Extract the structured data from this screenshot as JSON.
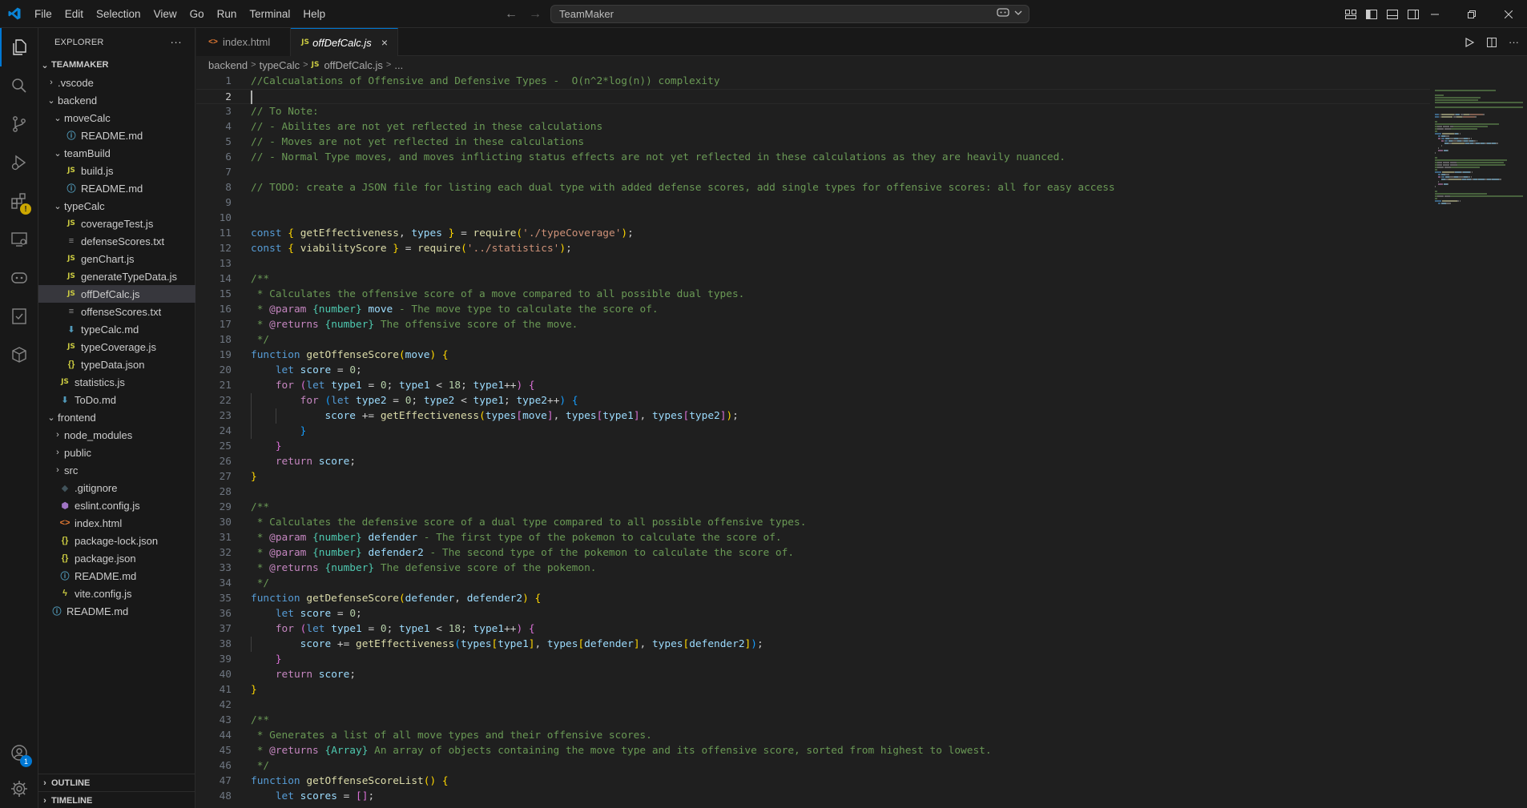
{
  "titlebar": {
    "menu": [
      "File",
      "Edit",
      "Selection",
      "View",
      "Go",
      "Run",
      "Terminal",
      "Help"
    ],
    "search_text": "TeamMaker",
    "icons": [
      "vscode-logo-icon",
      "back-arrow-icon",
      "forward-arrow-icon",
      "copilot-icon",
      "chevron-down-icon",
      "customize-layout-icon",
      "toggle-sidebar-icon",
      "toggle-panel-icon",
      "toggle-secondary-sidebar-icon",
      "minimize-icon",
      "restore-icon",
      "close-icon"
    ]
  },
  "activitybar": {
    "items": [
      "explorer-icon",
      "search-icon",
      "source-control-icon",
      "run-debug-icon",
      "extensions-icon",
      "remote-explorer-icon",
      "copilot-icon",
      "testing-icon",
      "containers-icon"
    ],
    "accounts_badge": "1",
    "bottom": [
      "accounts-icon",
      "manage-gear-icon"
    ]
  },
  "sidebar": {
    "title": "EXPLORER",
    "more": "···",
    "root": "TEAMMAKER",
    "tree": [
      {
        "label": ".vscode",
        "depth": 1,
        "type": "folder",
        "open": false
      },
      {
        "label": "backend",
        "depth": 1,
        "type": "folder",
        "open": true
      },
      {
        "label": "moveCalc",
        "depth": 2,
        "type": "folder",
        "open": true
      },
      {
        "label": "README.md",
        "depth": 3,
        "type": "info"
      },
      {
        "label": "teamBuild",
        "depth": 2,
        "type": "folder",
        "open": true
      },
      {
        "label": "build.js",
        "depth": 3,
        "type": "js"
      },
      {
        "label": "README.md",
        "depth": 3,
        "type": "info"
      },
      {
        "label": "typeCalc",
        "depth": 2,
        "type": "folder",
        "open": true
      },
      {
        "label": "coverageTest.js",
        "depth": 3,
        "type": "js"
      },
      {
        "label": "defenseScores.txt",
        "depth": 3,
        "type": "txt"
      },
      {
        "label": "genChart.js",
        "depth": 3,
        "type": "js"
      },
      {
        "label": "generateTypeData.js",
        "depth": 3,
        "type": "js"
      },
      {
        "label": "offDefCalc.js",
        "depth": 3,
        "type": "js",
        "selected": true
      },
      {
        "label": "offenseScores.txt",
        "depth": 3,
        "type": "txt"
      },
      {
        "label": "typeCalc.md",
        "depth": 3,
        "type": "md"
      },
      {
        "label": "typeCoverage.js",
        "depth": 3,
        "type": "js"
      },
      {
        "label": "typeData.json",
        "depth": 3,
        "type": "json"
      },
      {
        "label": "statistics.js",
        "depth": 2,
        "type": "js"
      },
      {
        "label": "ToDo.md",
        "depth": 2,
        "type": "md"
      },
      {
        "label": "frontend",
        "depth": 1,
        "type": "folder",
        "open": true
      },
      {
        "label": "node_modules",
        "depth": 2,
        "type": "folder",
        "open": false
      },
      {
        "label": "public",
        "depth": 2,
        "type": "folder",
        "open": false
      },
      {
        "label": "src",
        "depth": 2,
        "type": "folder",
        "open": false
      },
      {
        "label": ".gitignore",
        "depth": 2,
        "type": "git"
      },
      {
        "label": "eslint.config.js",
        "depth": 2,
        "type": "eslint"
      },
      {
        "label": "index.html",
        "depth": 2,
        "type": "html"
      },
      {
        "label": "package-lock.json",
        "depth": 2,
        "type": "json"
      },
      {
        "label": "package.json",
        "depth": 2,
        "type": "json"
      },
      {
        "label": "README.md",
        "depth": 2,
        "type": "info"
      },
      {
        "label": "vite.config.js",
        "depth": 2,
        "type": "vite"
      },
      {
        "label": "README.md",
        "depth": 1,
        "type": "info"
      }
    ],
    "outline": "OUTLINE",
    "timeline": "TIMELINE"
  },
  "editor": {
    "tabs": [
      {
        "label": "index.html",
        "icon": "html-file-icon",
        "active": false
      },
      {
        "label": "offDefCalc.js",
        "icon": "js-file-icon",
        "active": true
      }
    ],
    "close_glyph": "×",
    "breadcrumb": [
      "backend",
      "typeCalc",
      "offDefCalc.js",
      "..."
    ],
    "breadcrumb_sep": ">",
    "js_icon_text": "JS",
    "html_icon_text": "<>",
    "current_line": 2,
    "lines": [
      [
        [
          "com",
          "//Calcualations of Offensive and Defensive Types -  O(n^2*log(n)) complexity"
        ]
      ],
      [],
      [
        [
          "com",
          "// To Note:"
        ]
      ],
      [
        [
          "com",
          "// - Abilites are not yet reflected in these calculations"
        ]
      ],
      [
        [
          "com",
          "// - Moves are not yet reflected in these calculations"
        ]
      ],
      [
        [
          "com",
          "// - Normal Type moves, and moves inflicting status effects are not yet reflected in these calculations as they are heavily nuanced."
        ]
      ],
      [],
      [
        [
          "com",
          "// TODO: create a JSON file for listing each dual type with added defense scores, add single types for offensive scores: all for easy access"
        ]
      ],
      [],
      [],
      [
        [
          "kw",
          "const"
        ],
        [
          "plain",
          " "
        ],
        [
          "b1",
          "{"
        ],
        [
          "plain",
          " "
        ],
        [
          "fn",
          "getEffectiveness"
        ],
        [
          "plain",
          ", "
        ],
        [
          "var",
          "types"
        ],
        [
          "plain",
          " "
        ],
        [
          "b1",
          "}"
        ],
        [
          "plain",
          " = "
        ],
        [
          "fn",
          "require"
        ],
        [
          "b1",
          "("
        ],
        [
          "str",
          "'./typeCoverage'"
        ],
        [
          "b1",
          ")"
        ],
        [
          "plain",
          ";"
        ]
      ],
      [
        [
          "kw",
          "const"
        ],
        [
          "plain",
          " "
        ],
        [
          "b1",
          "{"
        ],
        [
          "plain",
          " "
        ],
        [
          "fn",
          "viabilityScore"
        ],
        [
          "plain",
          " "
        ],
        [
          "b1",
          "}"
        ],
        [
          "plain",
          " = "
        ],
        [
          "fn",
          "require"
        ],
        [
          "b1",
          "("
        ],
        [
          "str",
          "'../statistics'"
        ],
        [
          "b1",
          ")"
        ],
        [
          "plain",
          ";"
        ]
      ],
      [],
      [
        [
          "com",
          "/**"
        ]
      ],
      [
        [
          "com",
          " * Calculates the offensive score of a move compared to all possible dual types."
        ]
      ],
      [
        [
          "com",
          " * "
        ],
        [
          "tag",
          "@param"
        ],
        [
          "com",
          " "
        ],
        [
          "type",
          "{number}"
        ],
        [
          "com",
          " "
        ],
        [
          "param",
          "move"
        ],
        [
          "com",
          " - The move type to calculate the score of."
        ]
      ],
      [
        [
          "com",
          " * "
        ],
        [
          "tag",
          "@returns"
        ],
        [
          "com",
          " "
        ],
        [
          "type",
          "{number}"
        ],
        [
          "com",
          " The offensive score of the move."
        ]
      ],
      [
        [
          "com",
          " */"
        ]
      ],
      [
        [
          "kw",
          "function"
        ],
        [
          "plain",
          " "
        ],
        [
          "fn",
          "getOffenseScore"
        ],
        [
          "b1",
          "("
        ],
        [
          "var",
          "move"
        ],
        [
          "b1",
          ")"
        ],
        [
          "plain",
          " "
        ],
        [
          "b1",
          "{"
        ]
      ],
      [
        [
          "plain",
          "    "
        ],
        [
          "kw",
          "let"
        ],
        [
          "plain",
          " "
        ],
        [
          "var",
          "score"
        ],
        [
          "plain",
          " = "
        ],
        [
          "num",
          "0"
        ],
        [
          "plain",
          ";"
        ]
      ],
      [
        [
          "plain",
          "    "
        ],
        [
          "ctrl",
          "for"
        ],
        [
          "plain",
          " "
        ],
        [
          "b2",
          "("
        ],
        [
          "kw",
          "let"
        ],
        [
          "plain",
          " "
        ],
        [
          "var",
          "type1"
        ],
        [
          "plain",
          " = "
        ],
        [
          "num",
          "0"
        ],
        [
          "plain",
          "; "
        ],
        [
          "var",
          "type1"
        ],
        [
          "plain",
          " < "
        ],
        [
          "num",
          "18"
        ],
        [
          "plain",
          "; "
        ],
        [
          "var",
          "type1"
        ],
        [
          "plain",
          "++"
        ],
        [
          "b2",
          ")"
        ],
        [
          "plain",
          " "
        ],
        [
          "b2",
          "{"
        ]
      ],
      [
        [
          "plain",
          "        "
        ],
        [
          "ctrl",
          "for"
        ],
        [
          "plain",
          " "
        ],
        [
          "b3",
          "("
        ],
        [
          "kw",
          "let"
        ],
        [
          "plain",
          " "
        ],
        [
          "var",
          "type2"
        ],
        [
          "plain",
          " = "
        ],
        [
          "num",
          "0"
        ],
        [
          "plain",
          "; "
        ],
        [
          "var",
          "type2"
        ],
        [
          "plain",
          " < "
        ],
        [
          "var",
          "type1"
        ],
        [
          "plain",
          "; "
        ],
        [
          "var",
          "type2"
        ],
        [
          "plain",
          "++"
        ],
        [
          "b3",
          ")"
        ],
        [
          "plain",
          " "
        ],
        [
          "b3",
          "{"
        ]
      ],
      [
        [
          "plain",
          "            "
        ],
        [
          "var",
          "score"
        ],
        [
          "plain",
          " += "
        ],
        [
          "fn",
          "getEffectiveness"
        ],
        [
          "b1",
          "("
        ],
        [
          "var",
          "types"
        ],
        [
          "b2",
          "["
        ],
        [
          "var",
          "move"
        ],
        [
          "b2",
          "]"
        ],
        [
          "plain",
          ", "
        ],
        [
          "var",
          "types"
        ],
        [
          "b2",
          "["
        ],
        [
          "var",
          "type1"
        ],
        [
          "b2",
          "]"
        ],
        [
          "plain",
          ", "
        ],
        [
          "var",
          "types"
        ],
        [
          "b2",
          "["
        ],
        [
          "var",
          "type2"
        ],
        [
          "b2",
          "]"
        ],
        [
          "b1",
          ")"
        ],
        [
          "plain",
          ";"
        ]
      ],
      [
        [
          "plain",
          "        "
        ],
        [
          "b3",
          "}"
        ]
      ],
      [
        [
          "plain",
          "    "
        ],
        [
          "b2",
          "}"
        ]
      ],
      [
        [
          "plain",
          "    "
        ],
        [
          "ctrl",
          "return"
        ],
        [
          "plain",
          " "
        ],
        [
          "var",
          "score"
        ],
        [
          "plain",
          ";"
        ]
      ],
      [
        [
          "b1",
          "}"
        ]
      ],
      [],
      [
        [
          "com",
          "/**"
        ]
      ],
      [
        [
          "com",
          " * Calculates the defensive score of a dual type compared to all possible offensive types."
        ]
      ],
      [
        [
          "com",
          " * "
        ],
        [
          "tag",
          "@param"
        ],
        [
          "com",
          " "
        ],
        [
          "type",
          "{number}"
        ],
        [
          "com",
          " "
        ],
        [
          "param",
          "defender"
        ],
        [
          "com",
          " - The first type of the pokemon to calculate the score of."
        ]
      ],
      [
        [
          "com",
          " * "
        ],
        [
          "tag",
          "@param"
        ],
        [
          "com",
          " "
        ],
        [
          "type",
          "{number}"
        ],
        [
          "com",
          " "
        ],
        [
          "param",
          "defender2"
        ],
        [
          "com",
          " - The second type of the pokemon to calculate the score of."
        ]
      ],
      [
        [
          "com",
          " * "
        ],
        [
          "tag",
          "@returns"
        ],
        [
          "com",
          " "
        ],
        [
          "type",
          "{number}"
        ],
        [
          "com",
          " The defensive score of the pokemon."
        ]
      ],
      [
        [
          "com",
          " */"
        ]
      ],
      [
        [
          "kw",
          "function"
        ],
        [
          "plain",
          " "
        ],
        [
          "fn",
          "getDefenseScore"
        ],
        [
          "b1",
          "("
        ],
        [
          "var",
          "defender"
        ],
        [
          "plain",
          ", "
        ],
        [
          "var",
          "defender2"
        ],
        [
          "b1",
          ")"
        ],
        [
          "plain",
          " "
        ],
        [
          "b1",
          "{"
        ]
      ],
      [
        [
          "plain",
          "    "
        ],
        [
          "kw",
          "let"
        ],
        [
          "plain",
          " "
        ],
        [
          "var",
          "score"
        ],
        [
          "plain",
          " = "
        ],
        [
          "num",
          "0"
        ],
        [
          "plain",
          ";"
        ]
      ],
      [
        [
          "plain",
          "    "
        ],
        [
          "ctrl",
          "for"
        ],
        [
          "plain",
          " "
        ],
        [
          "b2",
          "("
        ],
        [
          "kw",
          "let"
        ],
        [
          "plain",
          " "
        ],
        [
          "var",
          "type1"
        ],
        [
          "plain",
          " = "
        ],
        [
          "num",
          "0"
        ],
        [
          "plain",
          "; "
        ],
        [
          "var",
          "type1"
        ],
        [
          "plain",
          " < "
        ],
        [
          "num",
          "18"
        ],
        [
          "plain",
          "; "
        ],
        [
          "var",
          "type1"
        ],
        [
          "plain",
          "++"
        ],
        [
          "b2",
          ")"
        ],
        [
          "plain",
          " "
        ],
        [
          "b2",
          "{"
        ]
      ],
      [
        [
          "plain",
          "        "
        ],
        [
          "var",
          "score"
        ],
        [
          "plain",
          " += "
        ],
        [
          "fn",
          "getEffectiveness"
        ],
        [
          "b3",
          "("
        ],
        [
          "var",
          "types"
        ],
        [
          "b1",
          "["
        ],
        [
          "var",
          "type1"
        ],
        [
          "b1",
          "]"
        ],
        [
          "plain",
          ", "
        ],
        [
          "var",
          "types"
        ],
        [
          "b1",
          "["
        ],
        [
          "var",
          "defender"
        ],
        [
          "b1",
          "]"
        ],
        [
          "plain",
          ", "
        ],
        [
          "var",
          "types"
        ],
        [
          "b1",
          "["
        ],
        [
          "var",
          "defender2"
        ],
        [
          "b1",
          "]"
        ],
        [
          "b3",
          ")"
        ],
        [
          "plain",
          ";"
        ]
      ],
      [
        [
          "plain",
          "    "
        ],
        [
          "b2",
          "}"
        ]
      ],
      [
        [
          "plain",
          "    "
        ],
        [
          "ctrl",
          "return"
        ],
        [
          "plain",
          " "
        ],
        [
          "var",
          "score"
        ],
        [
          "plain",
          ";"
        ]
      ],
      [
        [
          "b1",
          "}"
        ]
      ],
      [],
      [
        [
          "com",
          "/**"
        ]
      ],
      [
        [
          "com",
          " * Generates a list of all move types and their offensive scores."
        ]
      ],
      [
        [
          "com",
          " * "
        ],
        [
          "tag",
          "@returns"
        ],
        [
          "com",
          " "
        ],
        [
          "type",
          "{Array}"
        ],
        [
          "com",
          " An array of objects containing the move type and its offensive score, sorted from highest to lowest."
        ]
      ],
      [
        [
          "com",
          " */"
        ]
      ],
      [
        [
          "kw",
          "function"
        ],
        [
          "plain",
          " "
        ],
        [
          "fn",
          "getOffenseScoreList"
        ],
        [
          "b1",
          "("
        ],
        [
          "b1",
          ")"
        ],
        [
          "plain",
          " "
        ],
        [
          "b1",
          "{"
        ]
      ],
      [
        [
          "plain",
          "    "
        ],
        [
          "kw",
          "let"
        ],
        [
          "plain",
          " "
        ],
        [
          "var",
          "scores"
        ],
        [
          "plain",
          " = "
        ],
        [
          "b2",
          "["
        ],
        [
          "b2",
          "]"
        ],
        [
          "plain",
          ";"
        ]
      ]
    ]
  }
}
